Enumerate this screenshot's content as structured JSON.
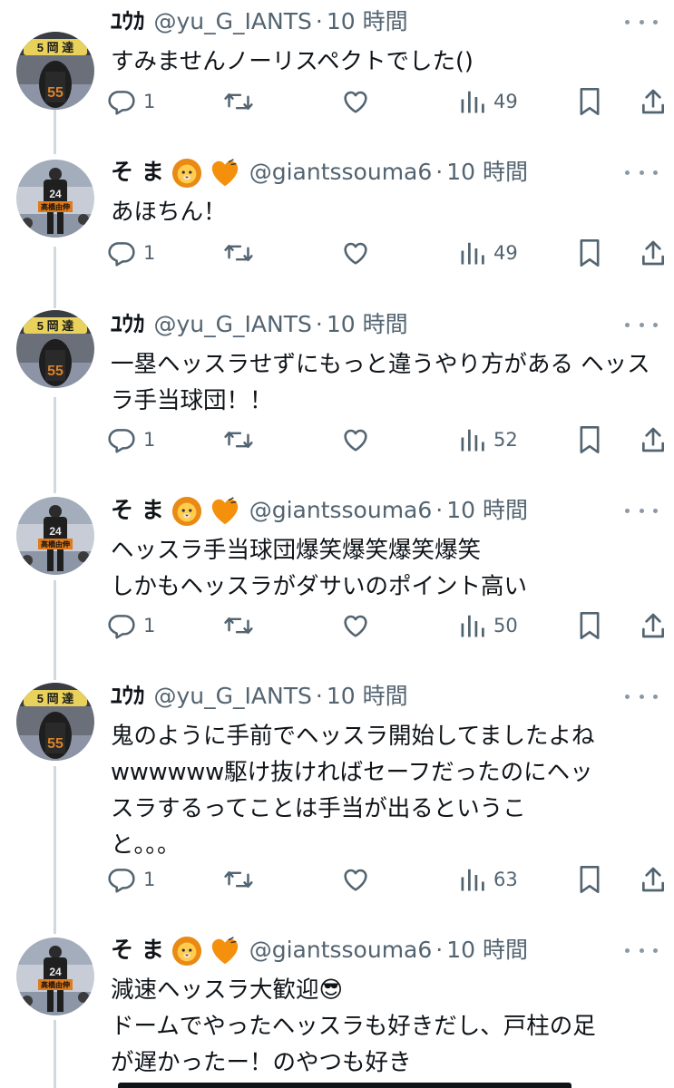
{
  "tweets": [
    {
      "name": "ﾕｳｶ",
      "avatar": "yuka",
      "name_emojis": [],
      "handle": "@yu_G_IANTS",
      "sep": "·",
      "time": "10 時間",
      "text": "すみませんノーリスペクトでした()",
      "reply_count": "1",
      "view_count": "49"
    },
    {
      "name": "そ ま",
      "avatar": "soma",
      "name_emojis": [
        "lion-face-emoji",
        "orange-heart-emoji"
      ],
      "handle": "@giantssouma6",
      "sep": "·",
      "time": "10 時間",
      "text": "あほちん！",
      "reply_count": "1",
      "view_count": "49"
    },
    {
      "name": "ﾕｳｶ",
      "avatar": "yuka",
      "name_emojis": [],
      "handle": "@yu_G_IANTS",
      "sep": "·",
      "time": "10 時間",
      "text": "一塁ヘッスラせずにもっと違うやり方がある ヘッスラ手当球団！！",
      "reply_count": "1",
      "view_count": "52"
    },
    {
      "name": "そ ま",
      "avatar": "soma",
      "name_emojis": [
        "lion-face-emoji",
        "orange-heart-emoji"
      ],
      "handle": "@giantssouma6",
      "sep": "·",
      "time": "10 時間",
      "text": "ヘッスラ手当球団爆笑爆笑爆笑爆笑\nしかもヘッスラがダサいのポイント高い",
      "reply_count": "1",
      "view_count": "50"
    },
    {
      "name": "ﾕｳｶ",
      "avatar": "yuka",
      "name_emojis": [],
      "handle": "@yu_G_IANTS",
      "sep": "·",
      "time": "10 時間",
      "text": "鬼のように手前でヘッスラ開始してましたよね\nwwwwww駆け抜ければセーフだったのにヘッ\nスラするってことは手当が出るというこ\nと。。。",
      "reply_count": "1",
      "view_count": "63"
    },
    {
      "name": "そ ま",
      "avatar": "soma",
      "name_emojis": [
        "lion-face-emoji",
        "orange-heart-emoji"
      ],
      "handle": "@giantssouma6",
      "sep": "·",
      "time": "10 時間",
      "text": "減速ヘッスラ大歓迎😎\nドームでやったヘッスラも好きだし、戸柱の足\nが遅かったー！のやつも好き",
      "reply_count": "",
      "view_count": ""
    }
  ],
  "icons": {
    "reply": "reply-icon",
    "repost": "repost-icon",
    "like": "like-icon",
    "views": "views-icon",
    "bookmark": "bookmark-icon",
    "share": "share-icon",
    "more": "more-icon"
  },
  "colors": {
    "text": "#0f1419",
    "muted": "#536471",
    "icon": "#536471",
    "thread_line": "#cfd9de",
    "background": "#ffffff"
  }
}
